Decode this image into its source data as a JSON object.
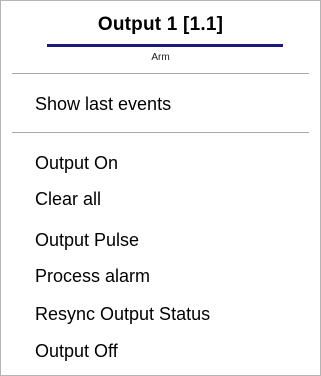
{
  "menu": {
    "title": "Output 1 [1.1]",
    "subtitle": "Arm",
    "accent_color": "#1a1a7a",
    "items_top": [
      {
        "label": "Show last events"
      }
    ],
    "items_bottom": [
      {
        "label": "Output On"
      },
      {
        "label": "Clear all"
      },
      {
        "label": "Output Pulse"
      },
      {
        "label": "Process alarm"
      },
      {
        "label": "Resync Output Status"
      },
      {
        "label": "Output Off"
      }
    ]
  }
}
